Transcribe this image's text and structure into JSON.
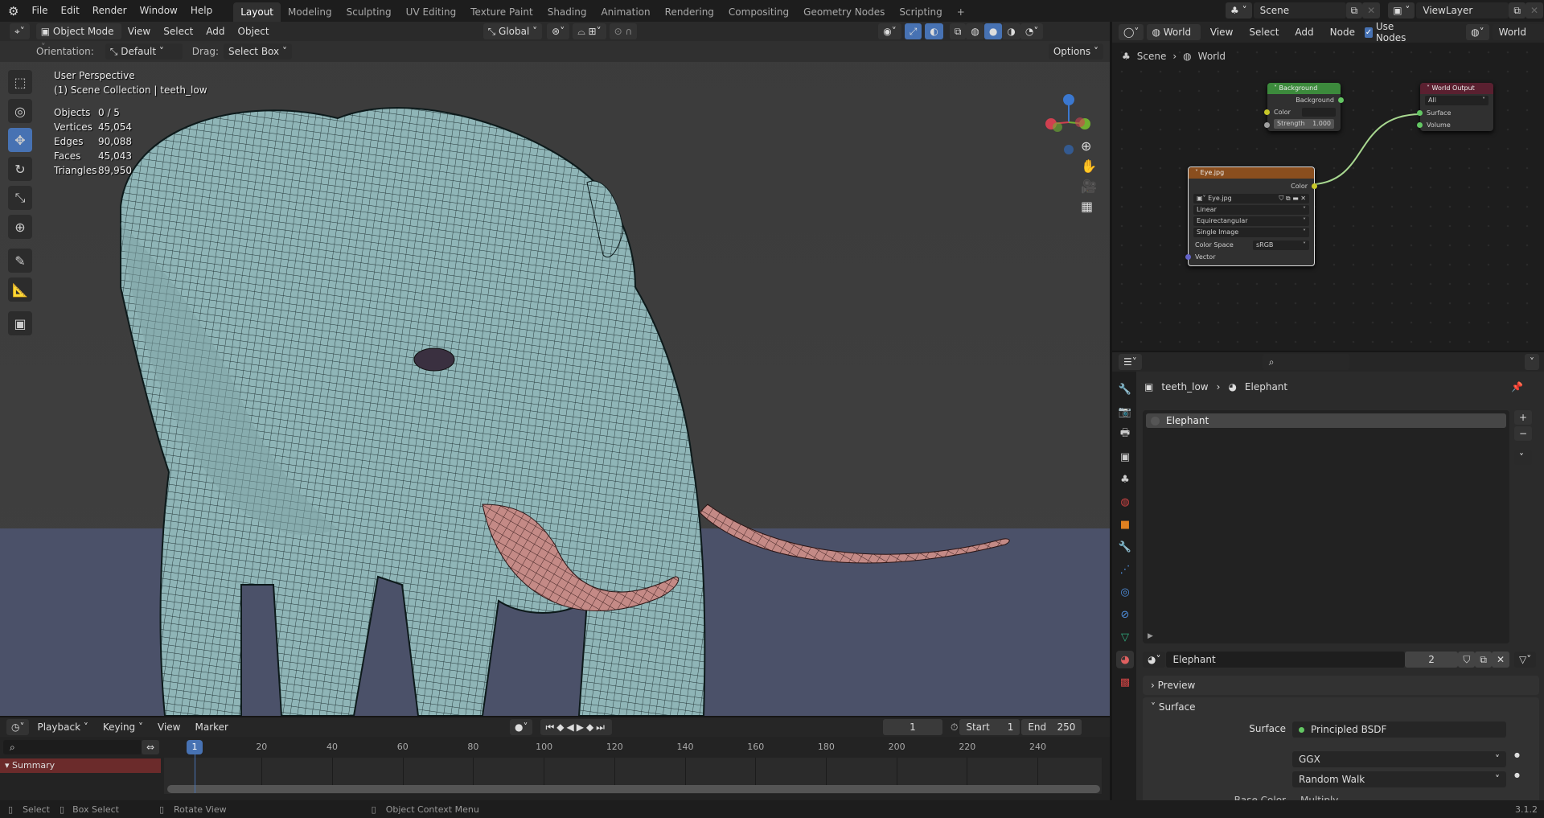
{
  "topbar": {
    "menus": [
      "File",
      "Edit",
      "Render",
      "Window",
      "Help"
    ],
    "workspaces": [
      "Layout",
      "Modeling",
      "Sculpting",
      "UV Editing",
      "Texture Paint",
      "Shading",
      "Animation",
      "Rendering",
      "Compositing",
      "Geometry Nodes",
      "Scripting"
    ],
    "active_workspace": "Layout",
    "add": "+",
    "scene": "Scene",
    "view_layer": "ViewLayer"
  },
  "viewport": {
    "mode": "Object Mode",
    "menus": [
      "View",
      "Select",
      "Add",
      "Object"
    ],
    "transform_orientation": "Global",
    "orientation_label": "Orientation:",
    "orientation_value": "Default",
    "drag_label": "Drag:",
    "drag_value": "Select Box",
    "options": "Options",
    "view_name": "User Perspective",
    "collection": "(1) Scene Collection | teeth_low",
    "stats": [
      {
        "label": "Objects",
        "value": "0 / 5"
      },
      {
        "label": "Vertices",
        "value": "45,054"
      },
      {
        "label": "Edges",
        "value": "90,088"
      },
      {
        "label": "Faces",
        "value": "45,043"
      },
      {
        "label": "Triangles",
        "value": "89,950"
      }
    ]
  },
  "node_editor": {
    "world": "World",
    "menus": [
      "View",
      "Select",
      "Add",
      "Node"
    ],
    "use_nodes": "Use Nodes",
    "use_nodes_checked": true,
    "world_right": "World",
    "breadcrumb": [
      "Scene",
      "World"
    ],
    "background_node": {
      "title": "Background",
      "output": "Background",
      "color": "Color",
      "strength_label": "Strength",
      "strength": "1.000"
    },
    "output_node": {
      "title": "World Output",
      "target": "All",
      "inputs": [
        "Surface",
        "Volume"
      ]
    },
    "image_node": {
      "title": "Eye.jpg",
      "output": "Color",
      "image": "Eye.jpg",
      "interpolation": "Linear",
      "projection": "Equirectangular",
      "source": "Single Image",
      "color_space_label": "Color Space",
      "color_space": "sRGB",
      "vector": "Vector"
    }
  },
  "properties": {
    "breadcrumb": [
      "teeth_low",
      "Elephant"
    ],
    "slots": [
      "Elephant"
    ],
    "material": "Elephant",
    "users": "2",
    "panels": {
      "preview": "Preview",
      "surface": "Surface"
    },
    "surface_label": "Surface",
    "surface_value": "Principled BSDF",
    "distribution": "GGX",
    "subsurface": "Random Walk",
    "base_color_label": "Base Color",
    "base_color_value": "Multiply"
  },
  "timeline": {
    "menus": [
      "Playback",
      "Keying",
      "View",
      "Marker"
    ],
    "current_frame": "1",
    "start_label": "Start",
    "start": "1",
    "end_label": "End",
    "end": "250",
    "summary": "Summary",
    "ticks": [
      20,
      40,
      60,
      80,
      100,
      120,
      140,
      160,
      180,
      200,
      220,
      240
    ],
    "playhead": 1
  },
  "status": {
    "select": "Select",
    "box_select": "Box Select",
    "rotate": "Rotate View",
    "context": "Object Context Menu",
    "version": "3.1.2"
  }
}
